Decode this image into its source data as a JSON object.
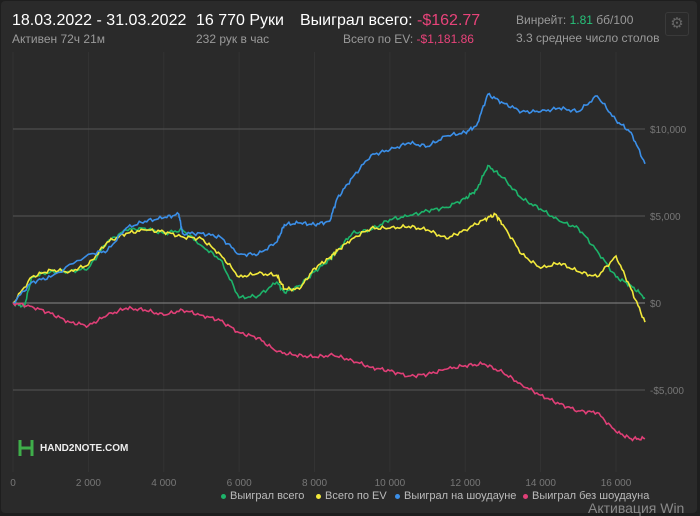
{
  "header": {
    "date_range": "18.03.2022 - 31.03.2022",
    "active": "Активен 72ч 21м",
    "hands": "16 770 Руки",
    "hands_per_hour": "232 рук в час",
    "won_label": "Выиграл всего:",
    "won_value": "-$162.77",
    "ev_label": "Всего по EV:",
    "ev_value": "-$1,181.86",
    "winrate_label": "Винрейт:",
    "winrate_value": "1.81",
    "winrate_unit": "бб/100",
    "tables": "3.3 среднее число столов",
    "settings_icon": "gear-icon"
  },
  "logo": {
    "text": "HAND2NOTE.COM"
  },
  "watermark": "Активация Win",
  "chart_data": {
    "type": "line",
    "xlim": [
      0,
      16770
    ],
    "ylim": [
      -9800,
      14400
    ],
    "grid": true,
    "legend_placement": "bottom-right",
    "x_ticks": [
      "0",
      "2 000",
      "4 000",
      "6 000",
      "8 000",
      "10 000",
      "12 000",
      "14 000",
      "16 000"
    ],
    "y_ticks": [
      "$10,000",
      "$5,000",
      "$0",
      "-$5,000"
    ],
    "series": [
      {
        "name": "Выиграл всего",
        "color": "#1db36a",
        "points": [
          [
            0,
            0
          ],
          [
            300,
            -200
          ],
          [
            500,
            1500
          ],
          [
            1000,
            1800
          ],
          [
            1500,
            1800
          ],
          [
            2000,
            2000
          ],
          [
            2500,
            3500
          ],
          [
            3000,
            4200
          ],
          [
            3500,
            4300
          ],
          [
            4000,
            4000
          ],
          [
            4500,
            4200
          ],
          [
            5000,
            3300
          ],
          [
            5500,
            2500
          ],
          [
            6000,
            300
          ],
          [
            6500,
            400
          ],
          [
            7000,
            1200
          ],
          [
            7200,
            600
          ],
          [
            7600,
            1000
          ],
          [
            8000,
            1800
          ],
          [
            8400,
            2500
          ],
          [
            8600,
            3000
          ],
          [
            9000,
            4000
          ],
          [
            9500,
            4200
          ],
          [
            10000,
            4800
          ],
          [
            10500,
            5000
          ],
          [
            11000,
            5300
          ],
          [
            11500,
            5500
          ],
          [
            12000,
            6000
          ],
          [
            12300,
            6500
          ],
          [
            12600,
            7900
          ],
          [
            13000,
            7200
          ],
          [
            13500,
            6000
          ],
          [
            14000,
            5400
          ],
          [
            14500,
            4700
          ],
          [
            15000,
            4300
          ],
          [
            15500,
            3000
          ],
          [
            16000,
            1500
          ],
          [
            16400,
            1000
          ],
          [
            16770,
            300
          ]
        ]
      },
      {
        "name": "Всего по EV",
        "color": "#f2e93b",
        "points": [
          [
            0,
            0
          ],
          [
            500,
            1500
          ],
          [
            1000,
            1900
          ],
          [
            1500,
            1800
          ],
          [
            2000,
            2200
          ],
          [
            2500,
            3500
          ],
          [
            3000,
            4000
          ],
          [
            3500,
            4200
          ],
          [
            4000,
            4100
          ],
          [
            4500,
            3800
          ],
          [
            5000,
            3700
          ],
          [
            5500,
            2800
          ],
          [
            6000,
            1500
          ],
          [
            6500,
            1700
          ],
          [
            7000,
            1600
          ],
          [
            7200,
            800
          ],
          [
            7600,
            800
          ],
          [
            8000,
            2000
          ],
          [
            8400,
            2600
          ],
          [
            8600,
            3000
          ],
          [
            9000,
            3700
          ],
          [
            9500,
            4300
          ],
          [
            10000,
            4300
          ],
          [
            10500,
            4400
          ],
          [
            11000,
            4200
          ],
          [
            11500,
            3700
          ],
          [
            12000,
            4200
          ],
          [
            12500,
            4800
          ],
          [
            12800,
            5100
          ],
          [
            13000,
            4500
          ],
          [
            13500,
            2800
          ],
          [
            14000,
            2000
          ],
          [
            14500,
            2300
          ],
          [
            15000,
            1800
          ],
          [
            15500,
            1500
          ],
          [
            16000,
            2700
          ],
          [
            16400,
            800
          ],
          [
            16770,
            -1100
          ]
        ]
      },
      {
        "name": "Выиграл на шоудауне",
        "color": "#3b8fe8",
        "points": [
          [
            0,
            0
          ],
          [
            500,
            1200
          ],
          [
            1000,
            1500
          ],
          [
            2000,
            2800
          ],
          [
            2500,
            3000
          ],
          [
            3000,
            4300
          ],
          [
            3500,
            4700
          ],
          [
            4000,
            4900
          ],
          [
            4400,
            5100
          ],
          [
            4500,
            4000
          ],
          [
            5000,
            4000
          ],
          [
            5500,
            3800
          ],
          [
            6000,
            2800
          ],
          [
            6500,
            2800
          ],
          [
            7000,
            3500
          ],
          [
            7200,
            4500
          ],
          [
            7600,
            4600
          ],
          [
            8000,
            4500
          ],
          [
            8400,
            4700
          ],
          [
            8600,
            6000
          ],
          [
            9000,
            7200
          ],
          [
            9500,
            8500
          ],
          [
            10000,
            8800
          ],
          [
            10500,
            9200
          ],
          [
            11000,
            9000
          ],
          [
            11500,
            9600
          ],
          [
            12000,
            9800
          ],
          [
            12300,
            10200
          ],
          [
            12600,
            12000
          ],
          [
            13000,
            11500
          ],
          [
            13500,
            11000
          ],
          [
            14000,
            11000
          ],
          [
            14500,
            11200
          ],
          [
            15000,
            11000
          ],
          [
            15500,
            11900
          ],
          [
            16000,
            10500
          ],
          [
            16400,
            9800
          ],
          [
            16770,
            8000
          ]
        ]
      },
      {
        "name": "Выиграл без шоудауна",
        "color": "#e03f77",
        "points": [
          [
            0,
            0
          ],
          [
            500,
            -200
          ],
          [
            1000,
            -600
          ],
          [
            1500,
            -1100
          ],
          [
            2000,
            -1300
          ],
          [
            2500,
            -700
          ],
          [
            3000,
            -300
          ],
          [
            3500,
            -400
          ],
          [
            4000,
            -700
          ],
          [
            4500,
            -400
          ],
          [
            5000,
            -700
          ],
          [
            5500,
            -1000
          ],
          [
            6000,
            -1700
          ],
          [
            6500,
            -2000
          ],
          [
            7000,
            -2800
          ],
          [
            7500,
            -3000
          ],
          [
            8000,
            -3100
          ],
          [
            8500,
            -3000
          ],
          [
            9000,
            -3300
          ],
          [
            9500,
            -3700
          ],
          [
            10000,
            -3900
          ],
          [
            10500,
            -4200
          ],
          [
            11000,
            -4100
          ],
          [
            11500,
            -3800
          ],
          [
            12000,
            -3600
          ],
          [
            12500,
            -3500
          ],
          [
            13000,
            -4000
          ],
          [
            13500,
            -4700
          ],
          [
            14000,
            -5300
          ],
          [
            14500,
            -5800
          ],
          [
            15000,
            -6200
          ],
          [
            15500,
            -6300
          ],
          [
            16000,
            -7400
          ],
          [
            16400,
            -7800
          ],
          [
            16770,
            -7800
          ]
        ]
      }
    ]
  }
}
